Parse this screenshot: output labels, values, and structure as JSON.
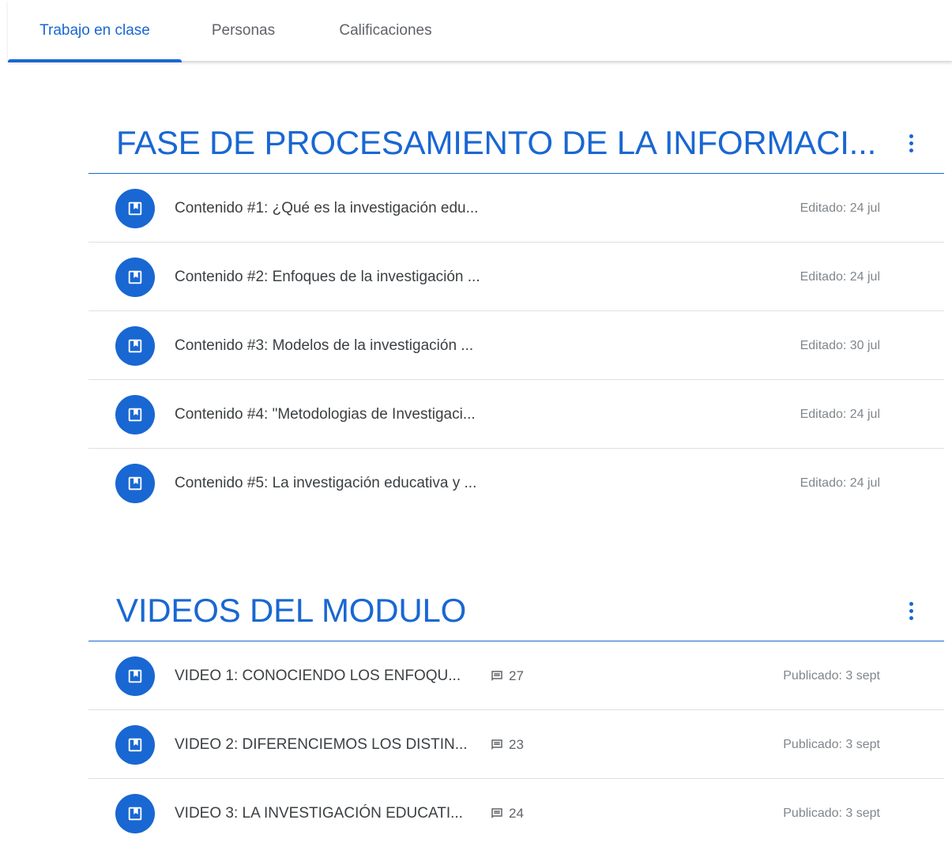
{
  "tabs": [
    {
      "label": "Trabajo en clase",
      "active": true
    },
    {
      "label": "Personas",
      "active": false
    },
    {
      "label": "Calificaciones",
      "active": false
    }
  ],
  "accent_color": "#1967d2",
  "icons": {
    "material": "class-material-icon",
    "more": "more-vert-icon",
    "comment": "comment-icon"
  },
  "topics": [
    {
      "title": "FASE DE PROCESAMIENTO DE LA INFORMACI...",
      "items": [
        {
          "title": "Contenido #1: ¿Qué es la investigación edu...",
          "date": "Editado: 24 jul"
        },
        {
          "title": "Contenido #2: Enfoques de la investigación ...",
          "date": "Editado: 24 jul"
        },
        {
          "title": "Contenido #3: Modelos de la investigación ...",
          "date": "Editado: 30 jul"
        },
        {
          "title": "Contenido #4: \"Metodologias de Investigaci...",
          "date": "Editado: 24 jul"
        },
        {
          "title": "Contenido #5: La investigación educativa y ...",
          "date": "Editado: 24 jul"
        }
      ]
    },
    {
      "title": "VIDEOS DEL MODULO",
      "items": [
        {
          "title": "VIDEO 1: CONOCIENDO LOS ENFOQU...",
          "comments": "27",
          "date": "Publicado: 3 sept"
        },
        {
          "title": "VIDEO 2: DIFERENCIEMOS LOS DISTIN...",
          "comments": "23",
          "date": "Publicado: 3 sept"
        },
        {
          "title": "VIDEO 3: LA INVESTIGACIÓN EDUCATI...",
          "comments": "24",
          "date": "Publicado: 3 sept"
        }
      ]
    }
  ]
}
